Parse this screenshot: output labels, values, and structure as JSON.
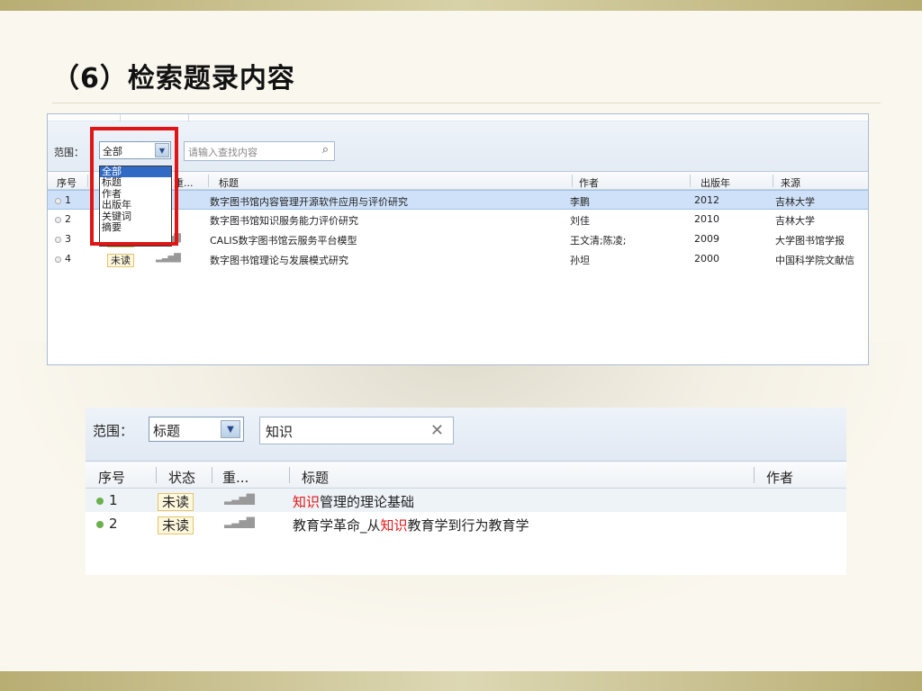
{
  "slide": {
    "title": "（6）检索题录内容"
  },
  "panel1": {
    "scope_label": "范围：",
    "scope_value": "全部",
    "search_placeholder": "请输入查找内容",
    "dropdown_options": [
      "全部",
      "标题",
      "作者",
      "出版年",
      "关键词",
      "摘要"
    ],
    "columns": [
      "序号",
      "重...",
      "标题",
      "作者",
      "出版年",
      "来源"
    ],
    "rows": [
      {
        "num": "1",
        "title": "数字图书馆内容管理开源软件应用与评价研究",
        "author": "李鹏",
        "year": "2012",
        "source": "吉林大学"
      },
      {
        "num": "2",
        "title": "数字图书馆知识服务能力评价研究",
        "author": "刘佳",
        "year": "2010",
        "source": "吉林大学"
      },
      {
        "num": "3",
        "status": "未读",
        "title": "CALIS数字图书馆云服务平台模型",
        "author": "王文清;陈凌;",
        "year": "2009",
        "source": "大学图书馆学报"
      },
      {
        "num": "4",
        "status": "未读",
        "title": "数字图书馆理论与发展模式研究",
        "author": "孙坦",
        "year": "2000",
        "source": "中国科学院文献信"
      }
    ]
  },
  "panel2": {
    "scope_label": "范围：",
    "scope_value": "标题",
    "search_value": "知识",
    "columns": [
      "序号",
      "状态",
      "重...",
      "标题",
      "作者"
    ],
    "rows": [
      {
        "num": "1",
        "status": "未读",
        "title_pre": "",
        "title_hl": "知识",
        "title_post": "管理的理论基础"
      },
      {
        "num": "2",
        "status": "未读",
        "title_pre": "教育学革命_从",
        "title_hl": "知识",
        "title_post": "教育学到行为教育学"
      }
    ]
  },
  "colors": {
    "accent_red": "#e01515",
    "selected_row": "#cfe1f9",
    "dot_green": "#6ab04c"
  },
  "icons": [
    "chevron-down-icon",
    "search-icon",
    "clear-icon",
    "signal-icon"
  ]
}
